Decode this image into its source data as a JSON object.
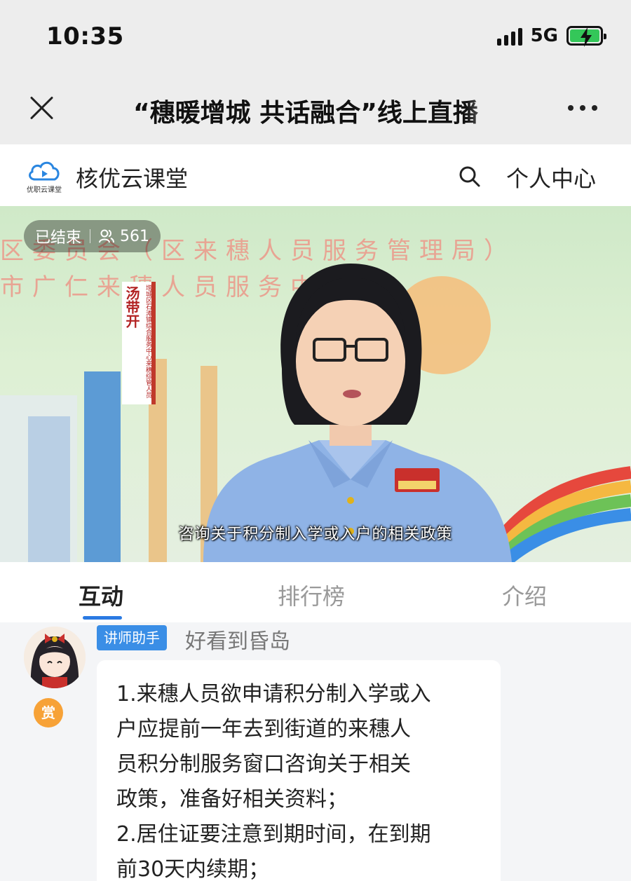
{
  "status_bar": {
    "time": "10:35",
    "network": "5G"
  },
  "nav": {
    "title": "“穗暖增城 共话融合”线上直播"
  },
  "site": {
    "logo_text": "优职云课堂",
    "name": "核优云课堂",
    "user_center": "个人中心"
  },
  "video": {
    "status": "已结束",
    "viewers": "561",
    "subtitle": "咨询关于积分制入学或入户的相关政策",
    "background_line1": "区委员会（区来穗人员服务管理局）",
    "background_line2": "市广仁来穗人员服务中心",
    "name_plate_name": "汤带开",
    "name_plate_role": "增城区石滩镇综合服务中心来穗综管人员"
  },
  "tabs": [
    {
      "label": "互动",
      "active": true
    },
    {
      "label": "排行榜",
      "active": false
    },
    {
      "label": "介绍",
      "active": false
    }
  ],
  "chat": {
    "messages": [
      {
        "role_tag": "讲师助手",
        "username": "好看到昏岛",
        "reward": "赏",
        "text": "1.来穗人员欲申请积分制入学或入\n户应提前一年去到街道的来穗人\n员积分制服务窗口咨询关于相关\n政策，准备好相关资料；\n2.居住证要注意到期时间，在到期\n前30天内续期；"
      }
    ]
  },
  "colors": {
    "accent": "#2a7ae2",
    "role_tag": "#3a8ee6",
    "reward": "#f7a237",
    "battery": "#34c759"
  }
}
